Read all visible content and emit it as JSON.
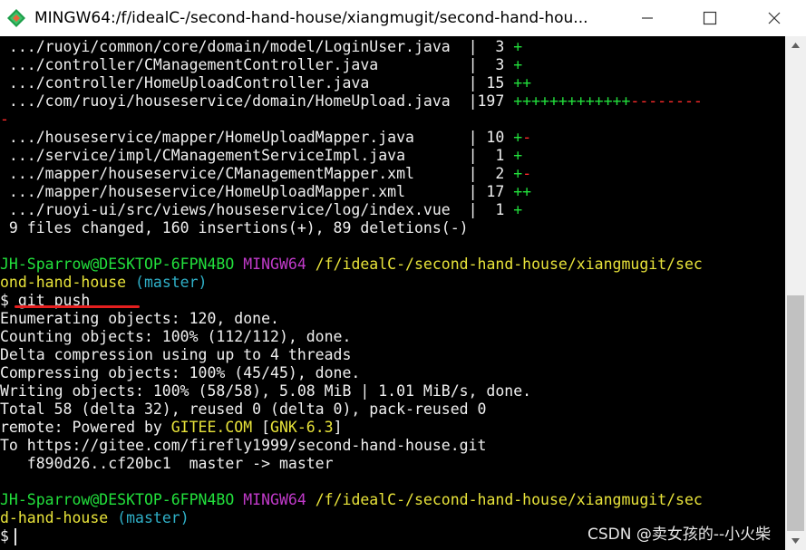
{
  "window": {
    "title": "MINGW64:/f/idealC-/second-hand-house/xiangmugit/second-hand-hou...",
    "app_icon": "git-bash-icon",
    "buttons": {
      "minimize": "minimize-icon",
      "maximize": "maximize-icon",
      "close": "close-icon"
    }
  },
  "terminal": {
    "stat_lines": [
      {
        "path": " .../ruoyi/common/core/domain/model/LoginUser.java  ",
        "count": "  3 ",
        "plus": "+",
        "minus": ""
      },
      {
        "path": " .../controller/CManagementController.java          ",
        "count": "  3 ",
        "plus": "+",
        "minus": ""
      },
      {
        "path": " .../controller/HomeUploadController.java           ",
        "count": " 15 ",
        "plus": "++",
        "minus": ""
      },
      {
        "path": " .../com/ruoyi/houseservice/domain/HomeUpload.java  ",
        "count": "197 ",
        "plus": "+++++++++++++",
        "minus": "--------"
      },
      {
        "path": " .../houseservice/mapper/HomeUploadMapper.java      ",
        "count": " 10 ",
        "plus": "+",
        "minus": "-"
      },
      {
        "path": " .../service/impl/CManagementServiceImpl.java       ",
        "count": "  1 ",
        "plus": "+",
        "minus": ""
      },
      {
        "path": " .../mapper/houseservice/CManagementMapper.xml      ",
        "count": "  2 ",
        "plus": "+",
        "minus": "-"
      },
      {
        "path": " .../mapper/houseservice/HomeUploadMapper.xml       ",
        "count": " 17 ",
        "plus": "++",
        "minus": ""
      },
      {
        "path": " .../ruoyi-ui/src/views/houseservice/log/index.vue  ",
        "count": "  1 ",
        "plus": "+",
        "minus": ""
      }
    ],
    "wrap_minus": "-",
    "separator": "|",
    "summary": " 9 files changed, 160 insertions(+), 89 deletions(-)",
    "prompt": {
      "user": "JH-Sparrow@DESKTOP-6FPN4BO",
      "shell": "MINGW64",
      "path_line1": "/f/idealC-/second-hand-house/xiangmugit/sec",
      "path_line2_a": "ond-hand-house",
      "path_line2_b": "d-hand-house",
      "branch": "(master)",
      "symbol": "$"
    },
    "command": "git push",
    "push_output": [
      "Enumerating objects: 120, done.",
      "Counting objects: 100% (112/112), done.",
      "Delta compression using up to 4 threads",
      "Compressing objects: 100% (45/45), done.",
      "Writing objects: 100% (58/58), 5.08 MiB | 1.01 MiB/s, done.",
      "Total 58 (delta 32), reused 0 (delta 0), pack-reused 0"
    ],
    "remote": {
      "prefix": "remote: Powered by ",
      "site": "GITEE.COM",
      "open": " [",
      "version": "GNK-6.3",
      "close": "]"
    },
    "to_line": "To https://gitee.com/firefly1999/second-hand-house.git",
    "ref_line": "   f890d26..cf20bc1  master -> master"
  },
  "watermark": "CSDN @卖女孩的--小火柴",
  "colors": {
    "background": "#000000",
    "text": "#f0f0f0",
    "green": "#22e03c",
    "red": "#ff2b2b",
    "magenta": "#c03ac9",
    "yellow": "#e8e33a",
    "cyan": "#2fb0c8",
    "annotation": "#e41f1f"
  }
}
